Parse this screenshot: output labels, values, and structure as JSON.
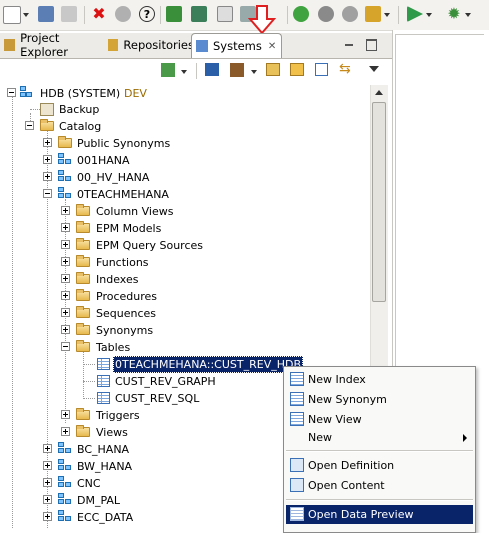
{
  "tabs": [
    {
      "label": "Project Explorer",
      "icon": "project-explorer-icon"
    },
    {
      "label": "Repositories",
      "icon": "repositories-icon"
    },
    {
      "label": "Systems",
      "icon": "systems-icon",
      "active": true
    }
  ],
  "tree": {
    "root": {
      "label": "HDB (SYSTEM)",
      "suffix": "DEV"
    },
    "backup": "Backup",
    "catalog": "Catalog",
    "catalog_children": {
      "public_synonyms": "Public Synonyms",
      "s001hana": "001HANA",
      "s00hvhana": "00_HV_HANA",
      "s0teach": "0TEACHMEHANA"
    },
    "schema_children": {
      "column_views": "Column Views",
      "epm_models": "EPM Models",
      "epm_query_sources": "EPM Query Sources",
      "functions": "Functions",
      "indexes": "Indexes",
      "procedures": "Procedures",
      "sequences": "Sequences",
      "synonyms": "Synonyms",
      "tables": "Tables",
      "triggers": "Triggers",
      "views": "Views"
    },
    "tables": {
      "t1": "0TEACHMEHANA::CUST_REV_HDB",
      "t2": "CUST_REV_GRAPH",
      "t3": "CUST_REV_SQL"
    },
    "more_schemas": {
      "bc_hana": "BC_HANA",
      "bw_hana": "BW_HANA",
      "cnc": "CNC",
      "dm_pal": "DM_PAL",
      "ecc_data": "ECC_DATA"
    }
  },
  "context_menu": {
    "new_index": "New Index",
    "new_synonym": "New Synonym",
    "new_view": "New View",
    "new": "New",
    "open_definition": "Open Definition",
    "open_content": "Open Content",
    "open_data_preview": "Open Data Preview"
  },
  "colors": {
    "selection": "#0a246a",
    "annotation_arrow": "#e02020"
  }
}
